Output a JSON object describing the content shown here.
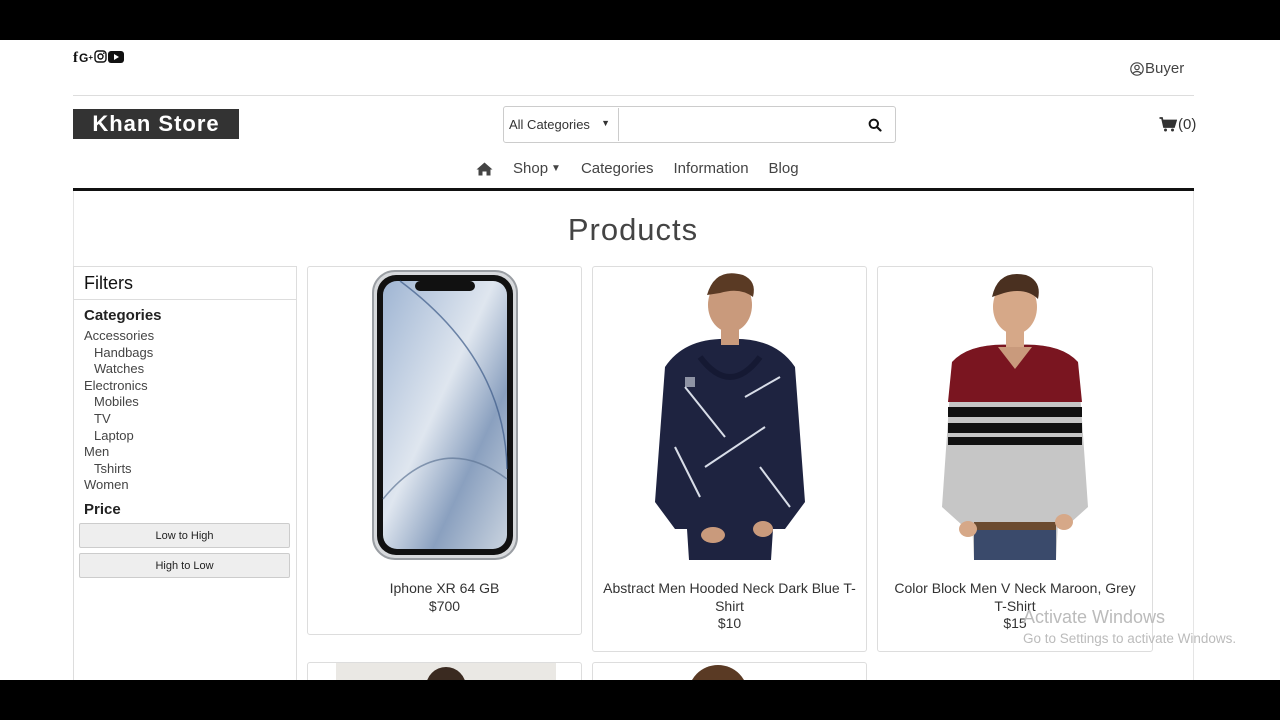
{
  "header": {
    "social_icons": [
      "facebook-icon",
      "google-plus-icon",
      "instagram-icon",
      "youtube-icon"
    ],
    "user_label": "Buyer",
    "logo": "Khan Store",
    "search": {
      "category": "All Categories",
      "placeholder": ""
    },
    "cart_count": "(0)"
  },
  "nav": {
    "items": [
      "Shop",
      "Categories",
      "Information",
      "Blog"
    ]
  },
  "main": {
    "title": "Products"
  },
  "filters": {
    "title": "Filters",
    "categories_title": "Categories",
    "categories": [
      {
        "label": "Accessories",
        "children": [
          "Handbags",
          "Watches"
        ]
      },
      {
        "label": "Electronics",
        "children": [
          "Mobiles",
          "TV",
          "Laptop"
        ]
      },
      {
        "label": "Men",
        "children": [
          "Tshirts"
        ]
      },
      {
        "label": "Women",
        "children": []
      }
    ],
    "price_title": "Price",
    "price_options": [
      "Low to High",
      "High to Low"
    ]
  },
  "products": [
    {
      "name": "Iphone XR 64 GB",
      "price": "$700",
      "image": "iphone-image"
    },
    {
      "name": "Abstract Men Hooded Neck Dark Blue T-Shirt",
      "price": "$10",
      "image": "navy-hoodie-image"
    },
    {
      "name": "Color Block Men V Neck Maroon, Grey T-Shirt",
      "price": "$15",
      "image": "maroon-grey-tshirt-image"
    }
  ],
  "watermark": {
    "line1": "Activate Windows",
    "line2": "Go to Settings to activate Windows."
  },
  "colors": {
    "logo_bg": "#333333",
    "nav_rule": "#111111",
    "hoodie": "#1e2340",
    "maroon": "#7a1520"
  }
}
